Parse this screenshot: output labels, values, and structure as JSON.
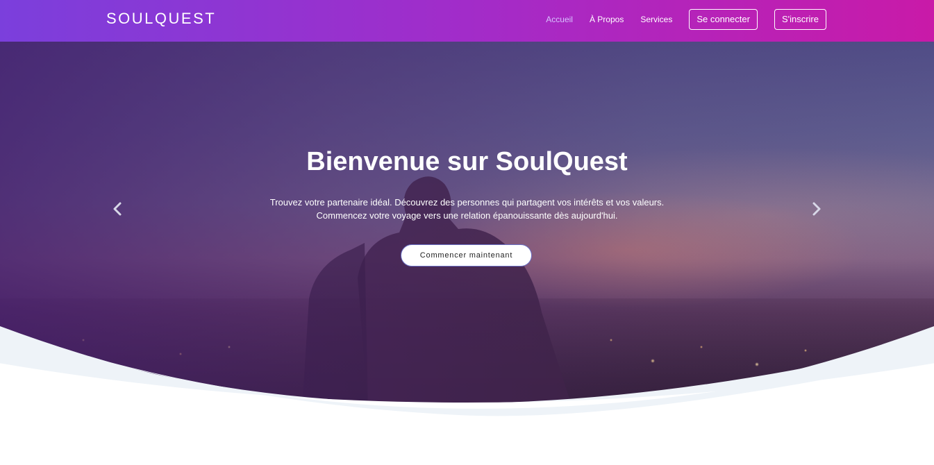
{
  "brand": {
    "name": "SOULQUEST"
  },
  "nav": {
    "links": [
      {
        "label": "Accueil",
        "active": true
      },
      {
        "label": "À Propos",
        "active": false
      },
      {
        "label": "Services",
        "active": false
      }
    ],
    "login_label": "Se connecter",
    "signup_label": "S'inscrire"
  },
  "hero": {
    "title": "Bienvenue sur SoulQuest",
    "line1": "Trouvez votre partenaire idéal. Découvrez des personnes qui partagent vos intérêts et vos valeurs.",
    "line2": "Commencez votre voyage vers une relation épanouissante dès aujourd'hui.",
    "cta_label": "Commencer maintenant",
    "prev_icon": "chevron-left-icon",
    "next_icon": "chevron-right-icon"
  },
  "colors": {
    "nav_gradient_start": "#7b3fdc",
    "nav_gradient_end": "#c91aa8",
    "active_link": "#d7c2ff",
    "wave_accent": "#eef3f8"
  }
}
